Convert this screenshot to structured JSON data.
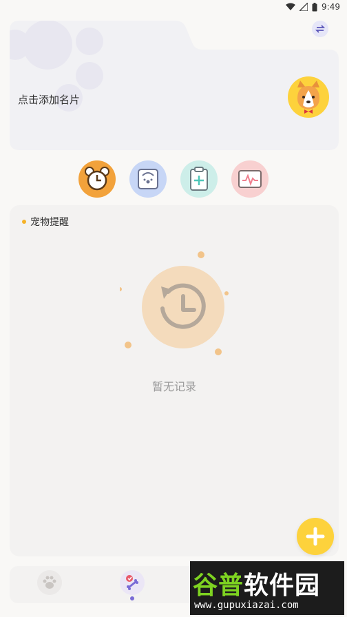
{
  "status_bar": {
    "time": "9:49"
  },
  "card": {
    "label": "点击添加名片",
    "switch_icon": "swap-icon",
    "avatar_icon": "corgi-avatar-icon"
  },
  "features": [
    {
      "name": "alarm-clock-icon",
      "color": "#f2a23b"
    },
    {
      "name": "weighing-scale-icon",
      "color": "#c7d6f6"
    },
    {
      "name": "medical-clipboard-icon",
      "color": "#cdeee9"
    },
    {
      "name": "health-monitor-icon",
      "color": "#f8d0d0"
    }
  ],
  "reminder": {
    "title": "宠物提醒",
    "empty_text": "暂无记录",
    "empty_icon": "history-clock-icon"
  },
  "fab": {
    "icon": "plus-icon",
    "color": "#fdd23c"
  },
  "bottom_nav": [
    {
      "name": "paw-tab-icon",
      "active": false
    },
    {
      "name": "bone-tab-icon",
      "active": true
    }
  ],
  "watermark": {
    "title_part1": "谷普",
    "title_part2": "软件园",
    "url": "www.gupuxiazai.com"
  }
}
